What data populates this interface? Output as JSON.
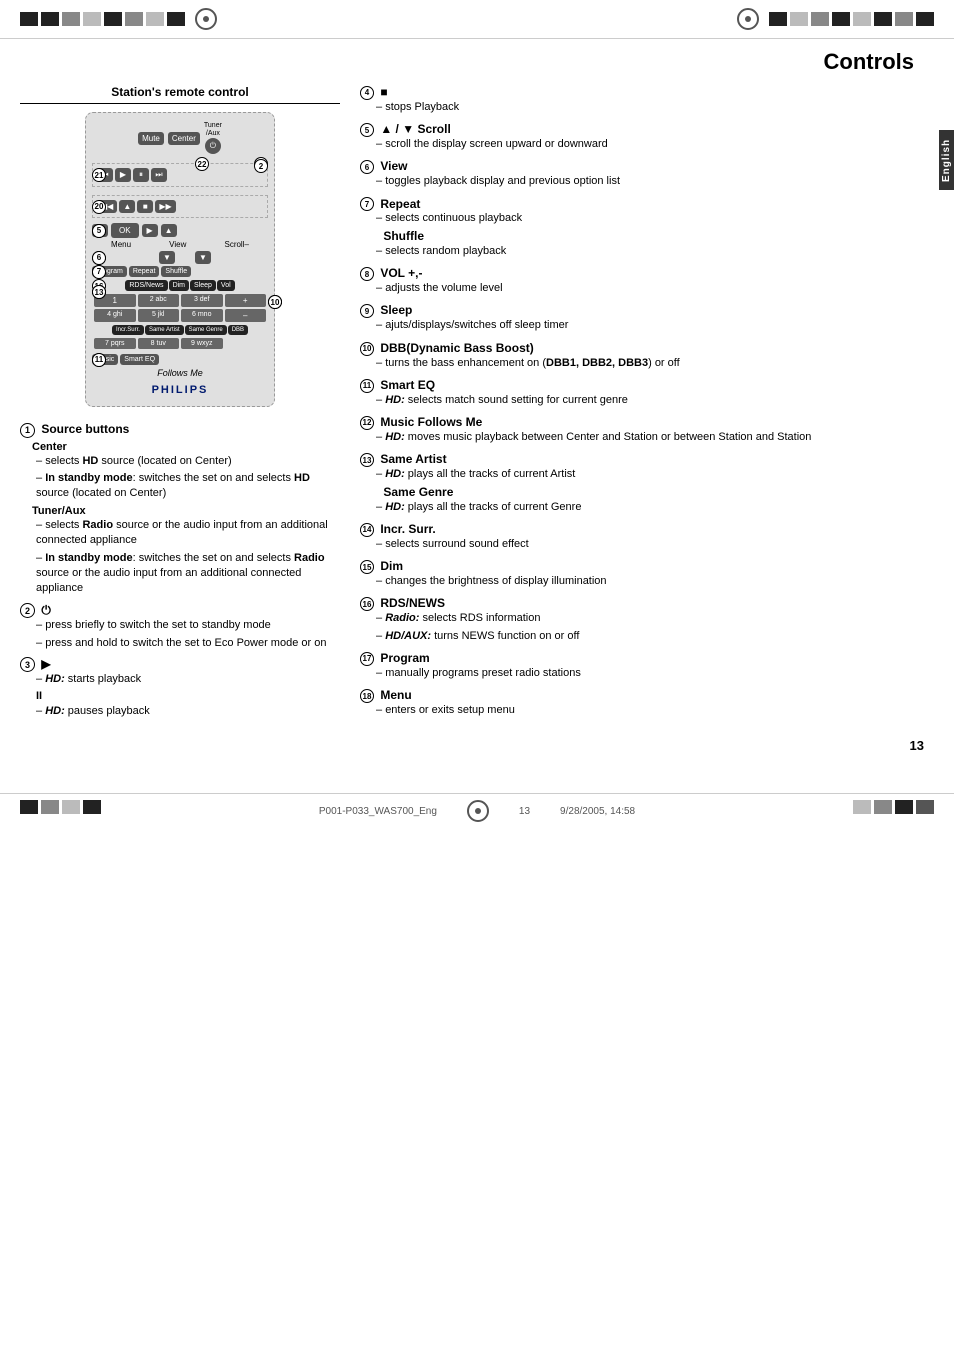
{
  "page": {
    "title": "Controls",
    "page_number": "13",
    "footer_left": "P001-P033_WAS700_Eng",
    "footer_middle": "13",
    "footer_right": "9/28/2005, 14:58"
  },
  "english_tab": "English",
  "remote_section": {
    "title": "Station's remote control"
  },
  "left_descriptions": [
    {
      "num": "1",
      "title": "Source buttons",
      "subtitles": [
        {
          "name": "Center",
          "bullets": [
            "selects HD source (located on Center)",
            "In standby mode: switches the set on and selects HD source (located on Center)"
          ]
        },
        {
          "name": "Tuner/Aux",
          "bullets": [
            "selects Radio source or the audio input from an additional connected appliance",
            "In standby mode: switches the set on and selects Radio source or the audio input from an additional connected appliance"
          ]
        }
      ]
    },
    {
      "num": "2",
      "symbol": "⏻",
      "bullets": [
        "press briefly to switch the set to standby mode",
        "press and hold to switch the set to Eco Power mode or on"
      ]
    },
    {
      "num": "3",
      "symbol": "▶",
      "sub_items": [
        {
          "label": "HD: starts playback"
        },
        {
          "bold_label": "II",
          "desc": "HD: pauses playback"
        }
      ]
    }
  ],
  "right_descriptions": [
    {
      "num": "4",
      "symbol": "■",
      "bullets": [
        "stops Playback"
      ]
    },
    {
      "num": "5",
      "title": "▲ / ▼ Scroll",
      "bullets": [
        "scroll the display screen upward or downward"
      ]
    },
    {
      "num": "6",
      "title": "View",
      "bullets": [
        "toggles playback display and previous option list"
      ]
    },
    {
      "num": "7",
      "title": "Repeat",
      "bullets": [
        "selects continuous playback"
      ],
      "extra": {
        "subtitle": "Shuffle",
        "bullets": [
          "selects random playback"
        ]
      }
    },
    {
      "num": "8",
      "title": "VOL +,-",
      "bullets": [
        "adjusts the volume level"
      ]
    },
    {
      "num": "9",
      "title": "Sleep",
      "bullets": [
        "ajuts/displays/switches off sleep timer"
      ]
    },
    {
      "num": "10",
      "title": "DBB(Dynamic Bass Boost)",
      "bullets": [
        "turns the bass enhancement on (DBB1, DBB2, DBB3) or off"
      ]
    },
    {
      "num": "11",
      "title": "Smart EQ",
      "bullets": [
        "HD: selects match sound setting for current genre"
      ]
    },
    {
      "num": "12",
      "title": "Music Follows Me",
      "bullets": [
        "HD: moves music playback between Center and Station or between Station and Station"
      ]
    },
    {
      "num": "13",
      "title": "Same Artist",
      "bullets": [
        "HD: plays all the tracks of current Artist"
      ],
      "extra": {
        "subtitle": "Same Genre",
        "bullets": [
          "HD: plays all the tracks of current Genre"
        ]
      }
    },
    {
      "num": "14",
      "title": "Incr. Surr.",
      "bullets": [
        "selects surround sound effect"
      ]
    },
    {
      "num": "15",
      "title": "Dim",
      "bullets": [
        "changes the brightness of display illumination"
      ]
    },
    {
      "num": "16",
      "title": "RDS/NEWS",
      "bullets": [
        "Radio: selects RDS information",
        "HD/AUX: turns NEWS function on or off"
      ]
    },
    {
      "num": "17",
      "title": "Program",
      "bullets": [
        "manually programs preset radio stations"
      ]
    },
    {
      "num": "18",
      "title": "Menu",
      "bullets": [
        "enters or exits setup menu"
      ]
    }
  ]
}
